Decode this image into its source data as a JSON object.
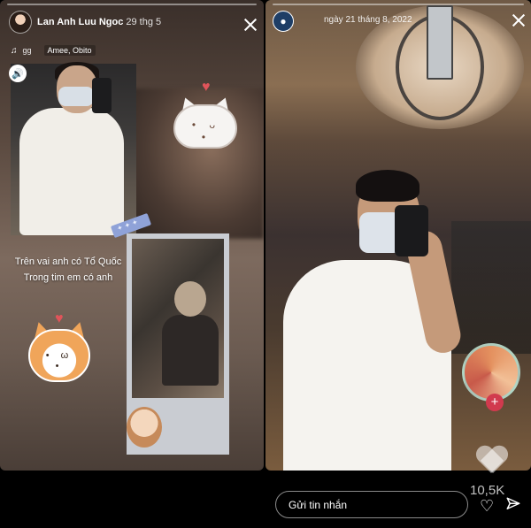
{
  "left_story": {
    "username": "Lan Anh Luu Ngoc",
    "time": "29 thg 5",
    "music_track": "gg",
    "music_artist": "Amee, Obito",
    "caption_line1": "Trên vai anh có Tổ Quốc",
    "caption_line2": "Trong tim em có anh"
  },
  "right_story": {
    "date": "ngày 21 tháng 8, 2022",
    "like_count": "10,5K",
    "reply_placeholder": "Gửi tin nhắn"
  },
  "icons": {
    "music": "music-note-icon",
    "sound": "speaker-icon",
    "close": "close-icon",
    "heart": "heart-icon",
    "send": "send-icon"
  },
  "colors": {
    "background": "#000000",
    "heart_red": "#e0545a",
    "reaction_plus": "#d13a4e"
  }
}
